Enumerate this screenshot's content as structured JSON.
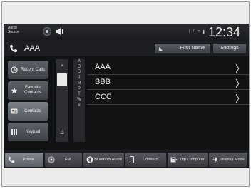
{
  "status": {
    "audio_source": "Audio Source",
    "status_icons": "! ᵀ ᵐ ▮",
    "clock": "12:34"
  },
  "header": {
    "contact": "AAA",
    "first_name_button": "First Name",
    "settings_button": "Settings"
  },
  "left_menu": {
    "items": [
      {
        "label": "Recent Calls",
        "icon": "clock-icon"
      },
      {
        "label": "Favorite Contacts",
        "icon": "star-icon"
      },
      {
        "label": "Contacts",
        "icon": "contact-card-icon",
        "active": true
      },
      {
        "label": "Keypad",
        "icon": "keypad-icon"
      }
    ]
  },
  "alphabet_index": [
    "A",
    "D",
    "G",
    "J",
    "M",
    "P",
    "T",
    "W",
    "#"
  ],
  "contacts": [
    {
      "name": "AAA"
    },
    {
      "name": "BBB"
    },
    {
      "name": "CCC"
    }
  ],
  "bottom_bar": {
    "tabs": [
      {
        "label": "Phone",
        "icon": "phone-icon",
        "active": true
      },
      {
        "label": "FM",
        "icon": "radio-icon"
      },
      {
        "label": "Bluetooth Audio",
        "icon": "bluetooth-icon"
      },
      {
        "label": "Connect",
        "icon": "smartphone-icon"
      },
      {
        "label": "Trip Computer",
        "icon": "trip-icon"
      },
      {
        "label": "Display Mode",
        "icon": "display-icon"
      }
    ]
  }
}
